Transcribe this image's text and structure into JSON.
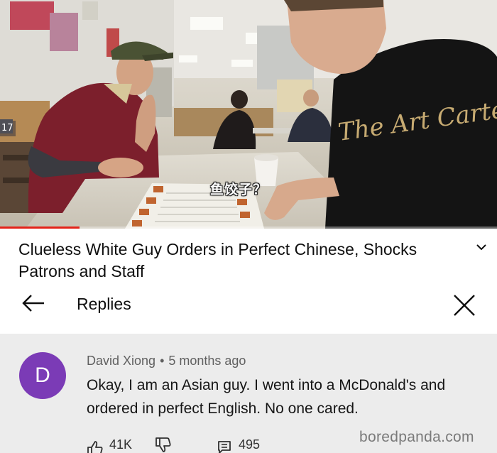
{
  "video": {
    "caption": "鱼饺子？",
    "shirt_text": "The Art Cartel",
    "wall_number": "17",
    "progress_fraction": 0.16
  },
  "header": {
    "title": "Clueless White Guy Orders in Perfect Chinese, Shocks Patrons and Staff",
    "expand_icon": "chevron-down-icon",
    "back_icon": "arrow-left-icon",
    "replies_label": "Replies",
    "close_icon": "close-icon"
  },
  "comment": {
    "avatar_letter": "D",
    "avatar_color": "#7b3bb6",
    "author": "David Xiong",
    "separator": "•",
    "time": "5 months ago",
    "text": "Okay, I am an Asian guy. I went into a McDonald's and ordered in perfect English. No one cared.",
    "likes": "41K",
    "like_icon": "thumbs-up-icon",
    "dislike_icon": "thumbs-down-icon",
    "reply_icon": "comment-icon",
    "replies_count": "495"
  },
  "watermark": "boredpanda.com"
}
